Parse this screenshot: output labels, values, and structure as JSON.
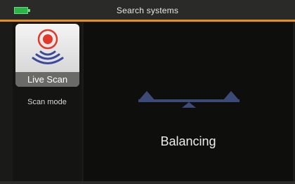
{
  "window": {
    "title": "Search systems"
  },
  "colors": {
    "accent": "#e8901e",
    "battery": "#2db34a",
    "balance_icon": "#3d4a78",
    "target_red": "#e23a2a",
    "wave_blue": "#3d4a9a"
  },
  "icons": {
    "battery": "battery-icon",
    "mode": "live-scan-icon",
    "status": "balance-icon"
  },
  "sidebar": {
    "mode_label": "Live Scan",
    "caption": "Scan mode"
  },
  "main": {
    "status_text": "Balancing"
  }
}
